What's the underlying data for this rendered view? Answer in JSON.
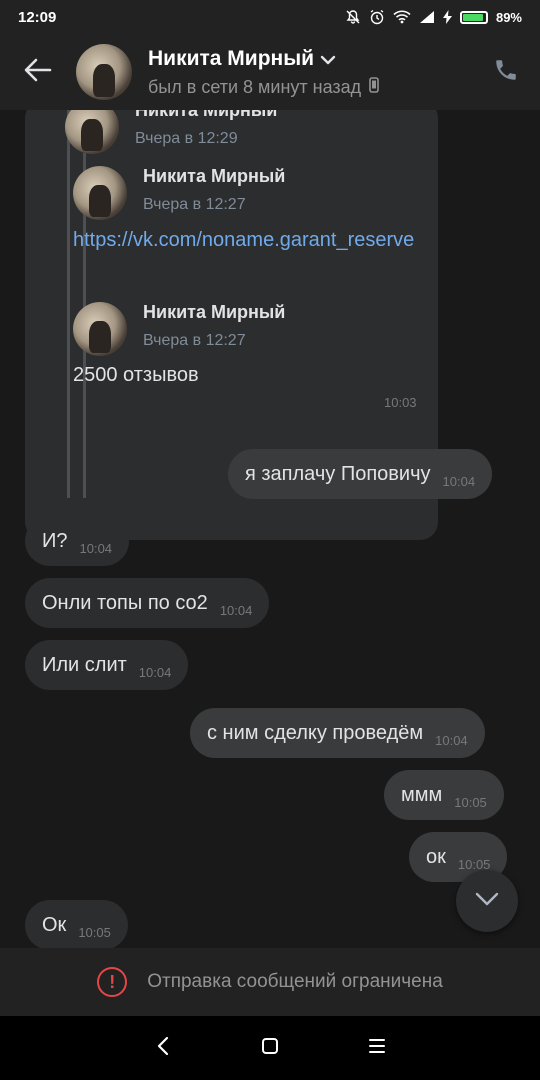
{
  "status_bar": {
    "time": "12:09",
    "battery": "89%",
    "battery_level": 0.89,
    "icons": [
      "mute-icon",
      "alarm-icon",
      "wifi-icon",
      "signal-icon",
      "charging-icon",
      "battery-icon"
    ]
  },
  "header": {
    "name": "Никита Мирный",
    "status": "был в сети 8 минут назад",
    "icons": [
      "back-arrow-icon",
      "chevron-down-icon",
      "mobile-icon",
      "phone-icon"
    ]
  },
  "forwarded": {
    "outer": {
      "author": "Никита Мирный",
      "time": "Вчера в 12:29"
    },
    "inner1": {
      "author": "Никита Мирный",
      "time": "Вчера в 12:27"
    },
    "link": "https://vk.com/noname.garant_reserve",
    "inner2": {
      "author": "Никита Мирный",
      "time": "Вчера в 12:27"
    },
    "text": "2500 отзывов",
    "sent_time": "10:03"
  },
  "messages": [
    {
      "direction": "out",
      "text": "я заплачу Поповичу",
      "time": "10:04"
    },
    {
      "direction": "in",
      "text": "И?",
      "time": "10:04"
    },
    {
      "direction": "in",
      "text": "Онли топы по со2",
      "time": "10:04"
    },
    {
      "direction": "in",
      "text": "Или слит",
      "time": "10:04"
    },
    {
      "direction": "out",
      "text": "с ним сделку проведём",
      "time": "10:04"
    },
    {
      "direction": "out",
      "text": "ммм",
      "time": "10:05"
    },
    {
      "direction": "out",
      "text": "ок",
      "time": "10:05"
    },
    {
      "direction": "in",
      "text": "Ок",
      "time": "10:05"
    }
  ],
  "restriction": {
    "text": "Отправка сообщений ограничена",
    "icon": "exclamation-circle-icon",
    "color": "#e64646"
  },
  "colors": {
    "link": "#71aaeb",
    "bubble_in": "#2c2d2e",
    "bubble_out": "#3a3b3c",
    "background": "#191919"
  }
}
